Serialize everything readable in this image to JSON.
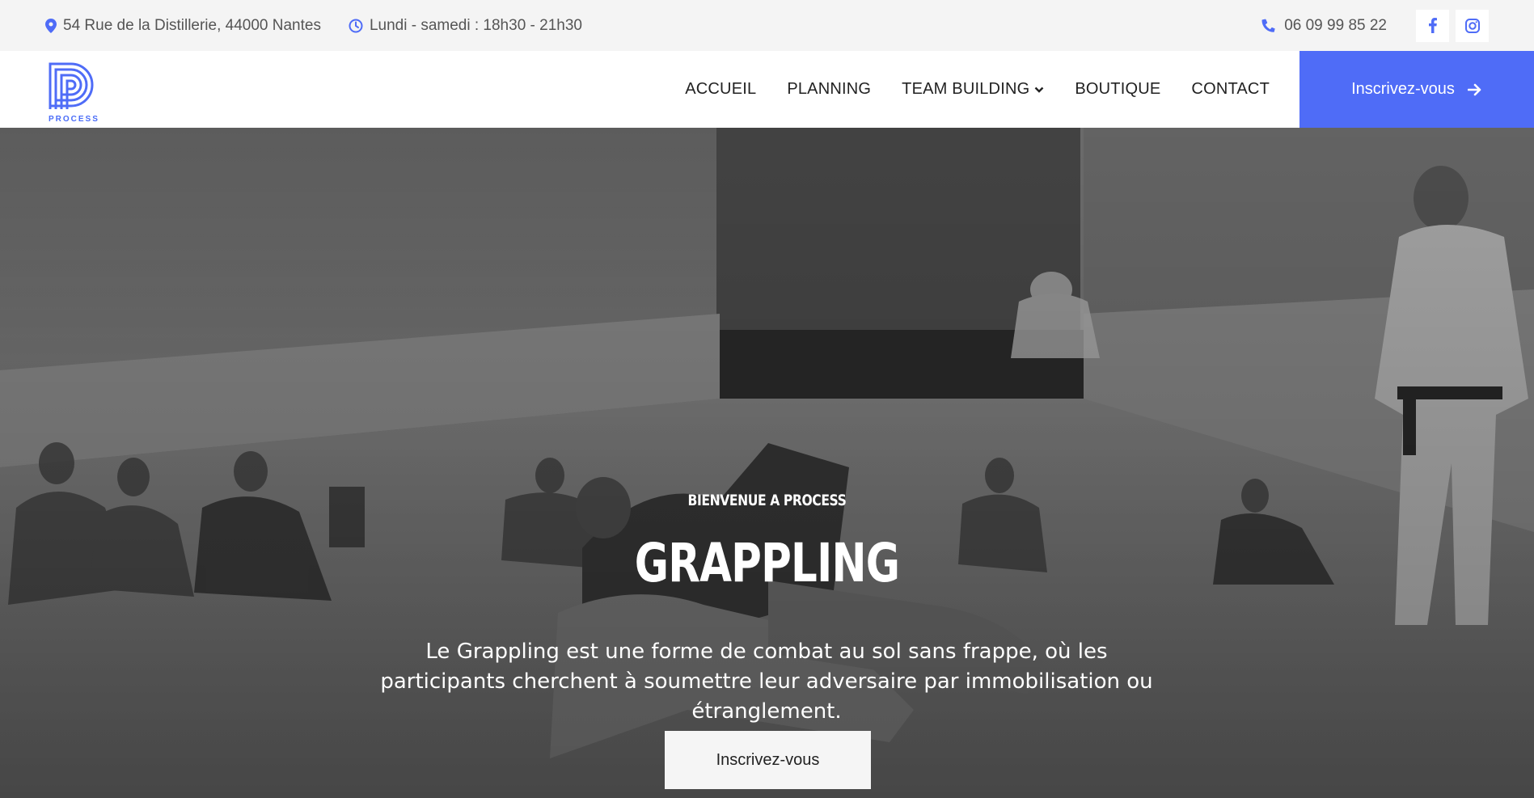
{
  "topbar": {
    "address": "54 Rue de la Distillerie, 44000 Nantes",
    "hours": "Lundi - samedi : 18h30 - 21h30",
    "phone": "06 09 99 85 22",
    "icons": [
      "map-pin-icon",
      "clock-icon",
      "phone-icon",
      "facebook-icon",
      "instagram-icon"
    ]
  },
  "header": {
    "logo_text": "PROCESS",
    "nav": [
      "ACCUEIL",
      "PLANNING",
      "TEAM BUILDING",
      "BOUTIQUE",
      "CONTACT"
    ],
    "cta_label": "Inscrivez-vous"
  },
  "hero": {
    "eyebrow": "BIENVENUE A PROCESS",
    "title": "GRAPPLING",
    "description": "Le Grappling est une forme de combat au sol sans frappe, où les participants cherchent à soumettre leur adversaire par immobilisation ou étranglement.",
    "button_label": "Inscrivez-vous"
  },
  "colors": {
    "accent": "#4f6cf7",
    "topbar_bg": "#f4f4f4",
    "hero_overlay": "#5a5a5a"
  }
}
